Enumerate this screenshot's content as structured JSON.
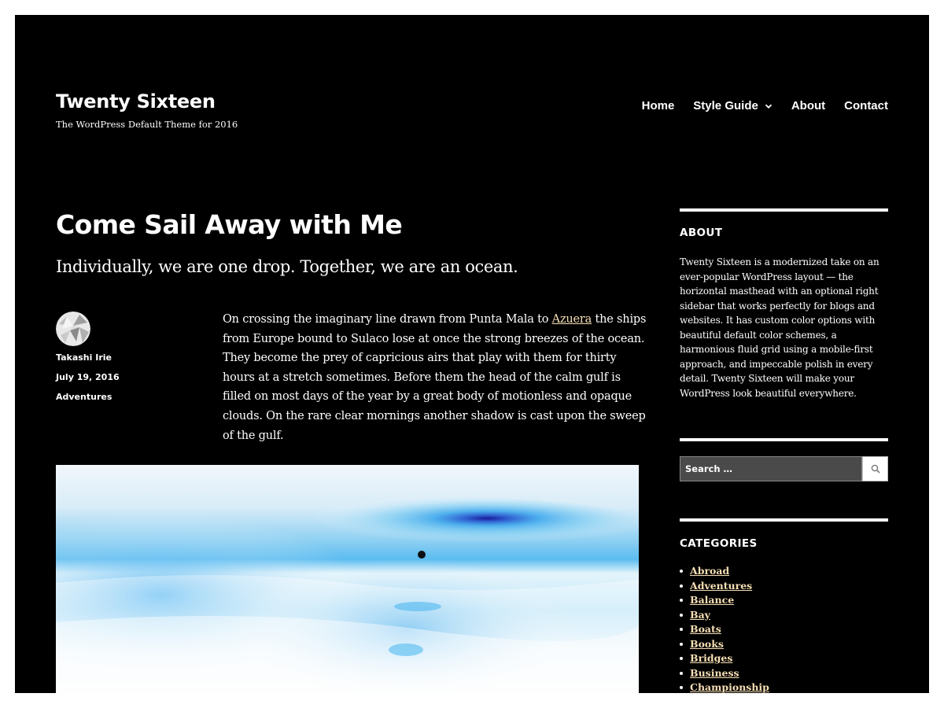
{
  "site": {
    "title": "Twenty Sixteen",
    "tagline": "The WordPress Default Theme for 2016"
  },
  "nav": {
    "items": [
      {
        "label": "Home"
      },
      {
        "label": "Style Guide",
        "has_submenu": true
      },
      {
        "label": "About"
      },
      {
        "label": "Contact"
      }
    ]
  },
  "post": {
    "title": "Come Sail Away with Me",
    "excerpt": "Individually, we are one drop. Together, we are an ocean.",
    "author": "Takashi Irie",
    "date": "July 19, 2016",
    "category": "Adventures",
    "body_before_link": "On crossing the imaginary line drawn from Punta Mala to ",
    "body_link": "Azuera",
    "body_after_link": " the ships from Europe bound to Sulaco lose at once the strong breezes of the ocean. They become the prey of capricious airs that play with them for thirty hours at a stretch sometimes. Before them the head of the calm gulf is filled on most days of the year by a great body of motionless and opaque clouds. On the rare clear mornings another shadow is cast upon the sweep of the gulf."
  },
  "sidebar": {
    "about_title": "ABOUT",
    "about_text": "Twenty Sixteen is a modernized take on an ever-popular WordPress layout — the horizontal masthead with an optional right sidebar that works perfectly for blogs and websites. It has custom color options with beautiful default color schemes, a harmonious fluid grid using a mobile-first approach, and impeccable polish in every detail. Twenty Sixteen will make your WordPress look beautiful everywhere.",
    "search_placeholder": "Search …",
    "categories_title": "CATEGORIES",
    "categories": [
      "Abroad",
      "Adventures",
      "Balance",
      "Bay",
      "Boats",
      "Books",
      "Bridges",
      "Business",
      "Championship"
    ]
  },
  "colors": {
    "background": "#000000",
    "text": "#ffffff",
    "link": "#f5deb3"
  },
  "icons": {
    "submenu": "chevron-down-icon",
    "search": "search-icon"
  }
}
